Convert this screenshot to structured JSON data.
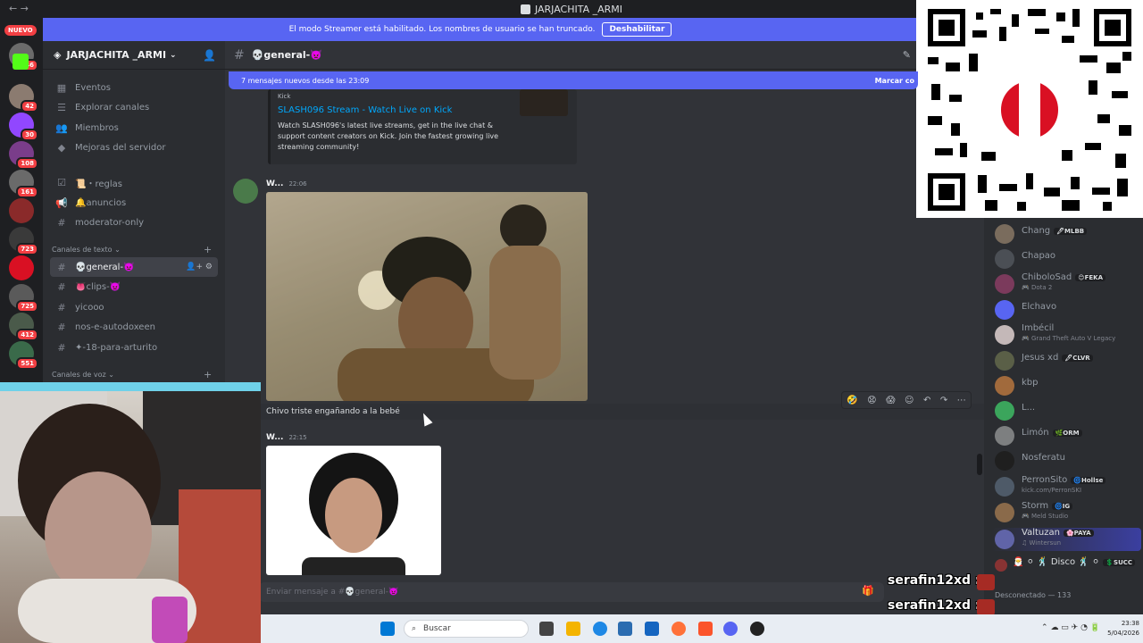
{
  "window": {
    "title": "JARJACHITA _ARMI",
    "nav": "← →"
  },
  "banner": {
    "text": "El modo Streamer está habilitado. Los nombres de usuario se han truncado.",
    "button": "Deshabilitar"
  },
  "rail": {
    "new_label": "NUEVO",
    "badges": [
      "46",
      "42",
      "30",
      "108",
      "161",
      "723",
      "725",
      "412",
      "551"
    ]
  },
  "guild": {
    "name": "JARJACHITA _ARMI"
  },
  "sidebar": {
    "top_items": [
      {
        "label": "Eventos",
        "icon": "calendar-icon"
      },
      {
        "label": "Explorar canales",
        "icon": "browse-icon"
      },
      {
        "label": "Miembros",
        "icon": "members-icon"
      },
      {
        "label": "Mejoras del servidor",
        "icon": "boost-icon"
      }
    ],
    "channels": [
      {
        "label": "📜・reglas",
        "icon": "rules-icon"
      },
      {
        "label": "🔔anuncios",
        "icon": "announce-icon"
      },
      {
        "label": "moderator-only",
        "icon": "hash-icon"
      }
    ],
    "text_category": "Canales de texto",
    "text_channels": [
      "💀general-👿",
      "👅clips-👿",
      "yicooo",
      "nos-e-autodoxeen",
      "✦-18-para-arturito"
    ],
    "voice_category": "Canales de voz"
  },
  "channel": {
    "name": "💀general-👿",
    "hash": "#"
  },
  "new_messages": {
    "text": "7 mensajes nuevos desde las 23:09",
    "mark": "Marcar co"
  },
  "embed": {
    "provider": "Kick",
    "title": "SLASH096 Stream - Watch Live on Kick",
    "description": "Watch SLASH096's latest live streams, get in the live chat & support content creators on Kick. Join the fastest growing live streaming community!"
  },
  "messages": [
    {
      "author": "W...",
      "time": "22:06",
      "text": "Chivo triste engañando a la bebé"
    },
    {
      "author": "W...",
      "time": "22:15"
    }
  ],
  "composer": {
    "placeholder": "Enviar mensaje a #💀general-👿"
  },
  "members": [
    {
      "name": "Chang",
      "tag": "🖊MLBB",
      "activity": "",
      "color": "#7a6c5d"
    },
    {
      "name": "Chapao",
      "tag": "",
      "activity": "",
      "color": "#4b4f55"
    },
    {
      "name": "ChiboloSad",
      "tag": "😊FEKA",
      "activity": "🎮 Dota 2",
      "color": "#7b3a5c"
    },
    {
      "name": "Elchavo",
      "tag": "",
      "activity": "",
      "color": "#5865f2"
    },
    {
      "name": "Imbécil",
      "tag": "",
      "activity": "🎮 Grand Theft Auto V Legacy",
      "color": "#c4b8b8"
    },
    {
      "name": "Jesus xd",
      "tag": "🖊CLVR",
      "activity": "",
      "color": "#5a5f47"
    },
    {
      "name": "kbp",
      "tag": "",
      "activity": "",
      "color": "#a16a3c"
    },
    {
      "name": "L...",
      "tag": "",
      "activity": "",
      "color": "#3ba55c"
    },
    {
      "name": "Limón",
      "tag": "🌿ORM",
      "activity": "",
      "color": "#7d7f80"
    },
    {
      "name": "Nosferatu",
      "tag": "",
      "activity": "",
      "color": "#1f1f1f"
    },
    {
      "name": "PerronSito",
      "tag": "🌀Hollse",
      "activity": "kick.com/PerronSKI",
      "color": "#4e5a68"
    },
    {
      "name": "Storm",
      "tag": "🌀IG",
      "activity": "🎮 Meld Studio",
      "color": "#8a6a4a"
    },
    {
      "name": "Valtuzan",
      "tag": "🌸PAYA",
      "activity": "♫ Wintersun",
      "color": "#6064a8"
    },
    {
      "name": "🎅 ⚪ 🕺 Disco 🕺 ⚪",
      "tag": "💲SUCC",
      "activity": "",
      "color": "#883333"
    }
  ],
  "disconnected": "Desconectado — 133",
  "chat_overlay": [
    "serafin12xd :",
    "serafin12xd :"
  ],
  "taskbar": {
    "search": "Buscar",
    "time": "23:38",
    "date": "5/04/2026"
  },
  "colors": {
    "blurple": "#5865f2",
    "bg": "#313338",
    "sidebar": "#2b2d31",
    "rail": "#1e1f22",
    "link": "#00a8fc",
    "red": "#f23f43",
    "flag_red": "#d91023"
  }
}
